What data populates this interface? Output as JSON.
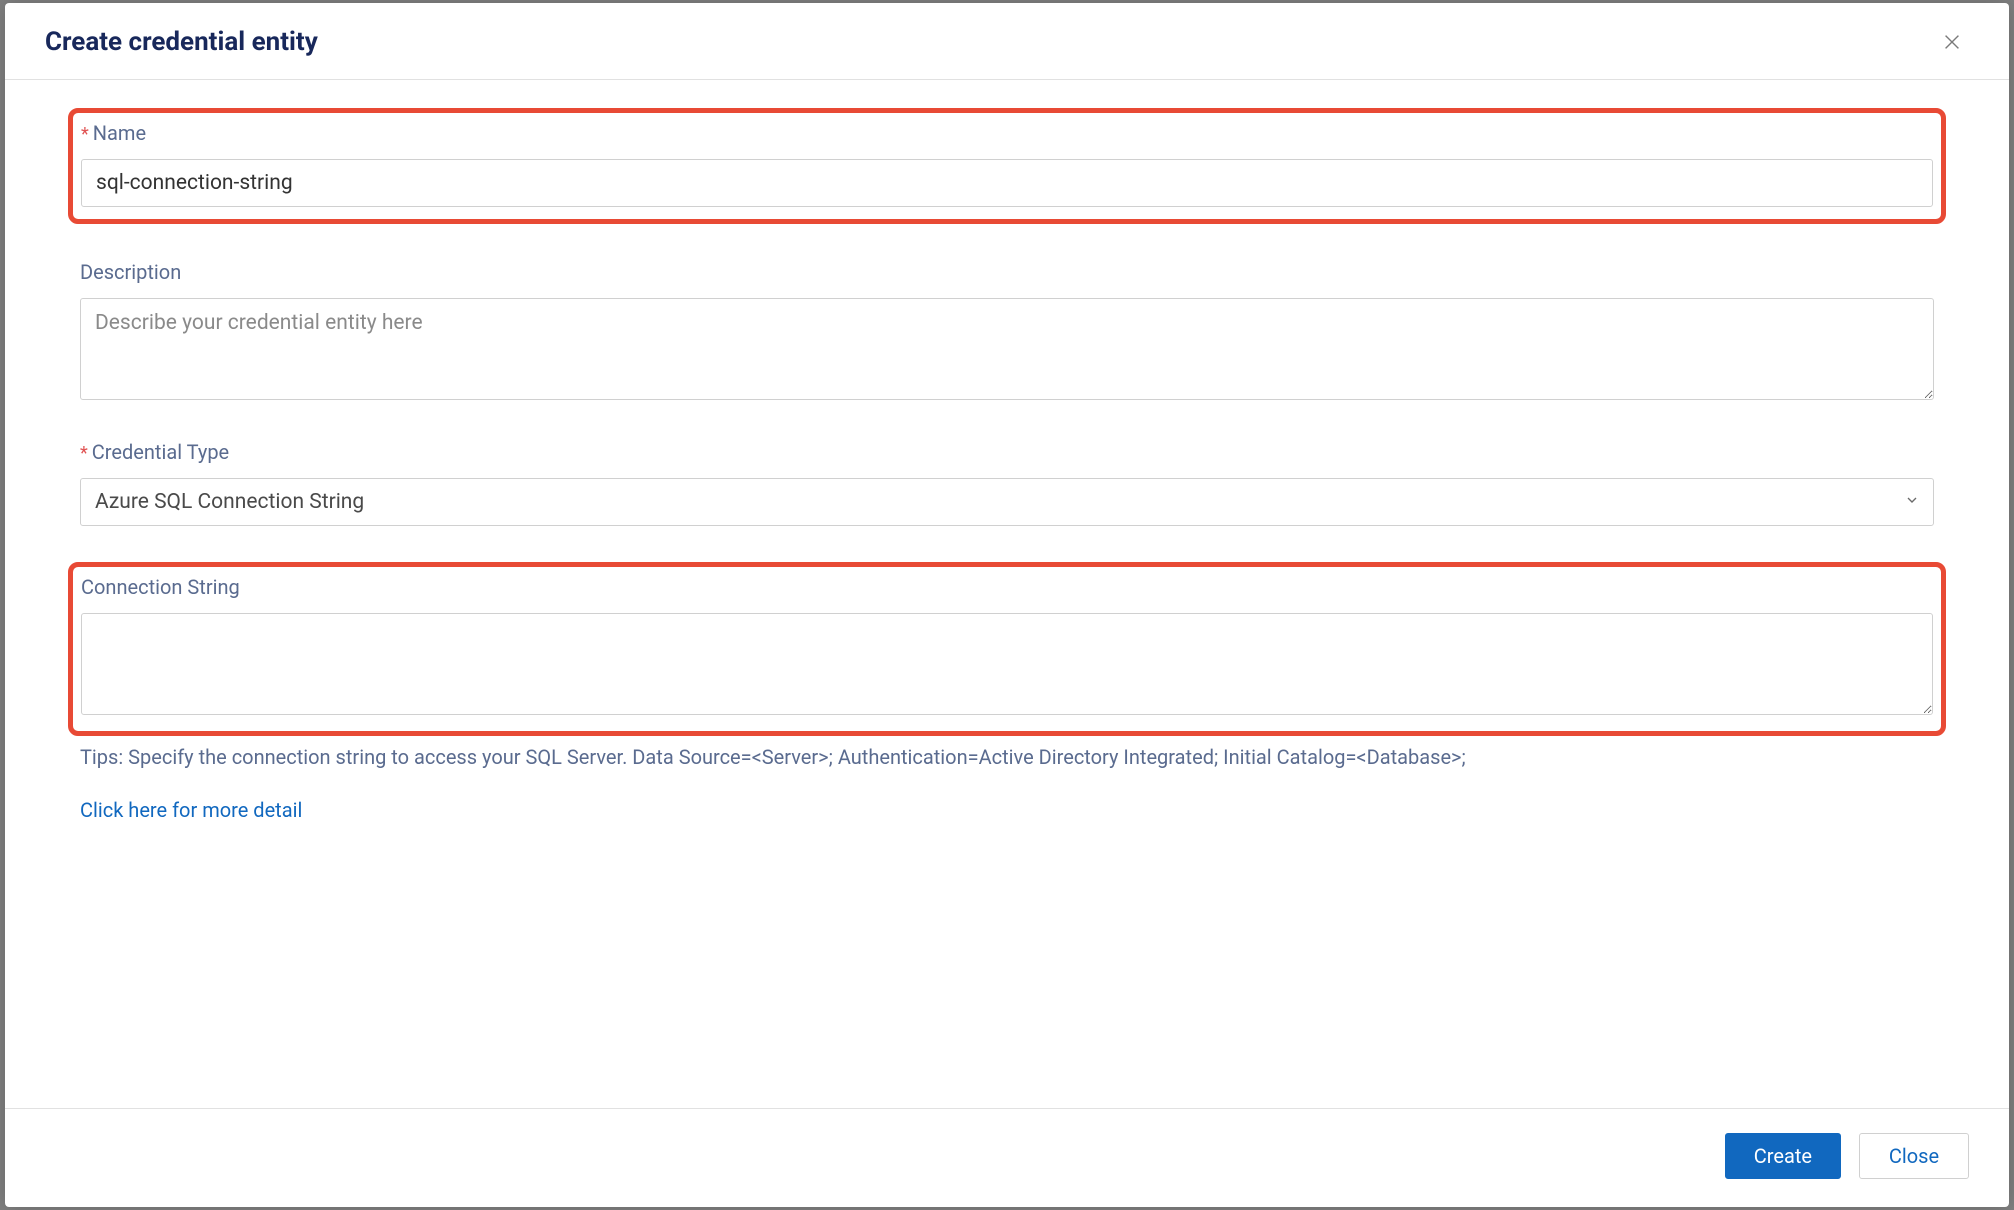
{
  "modal": {
    "title": "Create credential entity"
  },
  "form": {
    "name": {
      "label": "Name",
      "value": "sql-connection-string",
      "required": true
    },
    "description": {
      "label": "Description",
      "placeholder": "Describe your credential entity here",
      "value": ""
    },
    "credentialType": {
      "label": "Credential Type",
      "selected": "Azure SQL Connection String",
      "required": true
    },
    "connectionString": {
      "label": "Connection String",
      "value": ""
    },
    "tips": "Tips: Specify the connection string to access your SQL Server. Data Source=<Server>; Authentication=Active Directory Integrated; Initial Catalog=<Database>;",
    "detailLink": "Click here for more detail"
  },
  "footer": {
    "create": "Create",
    "close": "Close"
  }
}
